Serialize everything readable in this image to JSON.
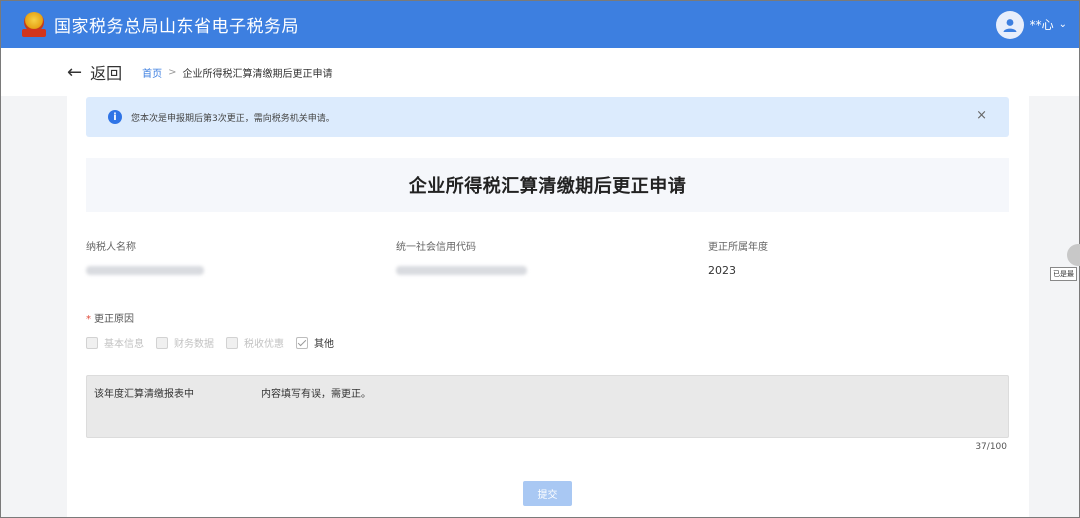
{
  "header": {
    "brand": "国家税务总局山东省电子税务局",
    "username": "**心",
    "caret": "⌄"
  },
  "breadcrumb": {
    "back_label": "返回",
    "home": "首页",
    "separator": ">",
    "current": "企业所得税汇算清缴期后更正申请"
  },
  "alert": {
    "message": "您本次是申报期后第3次更正，需向税务机关申请。",
    "close": "×"
  },
  "form": {
    "title": "企业所得税汇算清缴期后更正申请",
    "taxpayer_name_label": "纳税人名称",
    "credit_code_label": "统一社会信用代码",
    "year_label": "更正所属年度",
    "year_value": "2023",
    "reason_required_mark": "*",
    "reason_label": "更正原因",
    "reasons": [
      {
        "label": "基本信息",
        "checked": false
      },
      {
        "label": "财务数据",
        "checked": false
      },
      {
        "label": "税收优惠",
        "checked": false
      },
      {
        "label": "其他",
        "checked": true
      }
    ],
    "reason_text_part1": "该年度汇算清缴报表中",
    "reason_text_part2": "内容填写有误，需更正。",
    "char_counter": "37/100",
    "submit_label": "提交"
  },
  "side": {
    "label": "已是最"
  },
  "colors": {
    "header_blue": "#3d7fe0",
    "alert_bg": "#dcebfd",
    "submit_disabled": "#a9c8f3",
    "required_red": "#e04a3a"
  }
}
